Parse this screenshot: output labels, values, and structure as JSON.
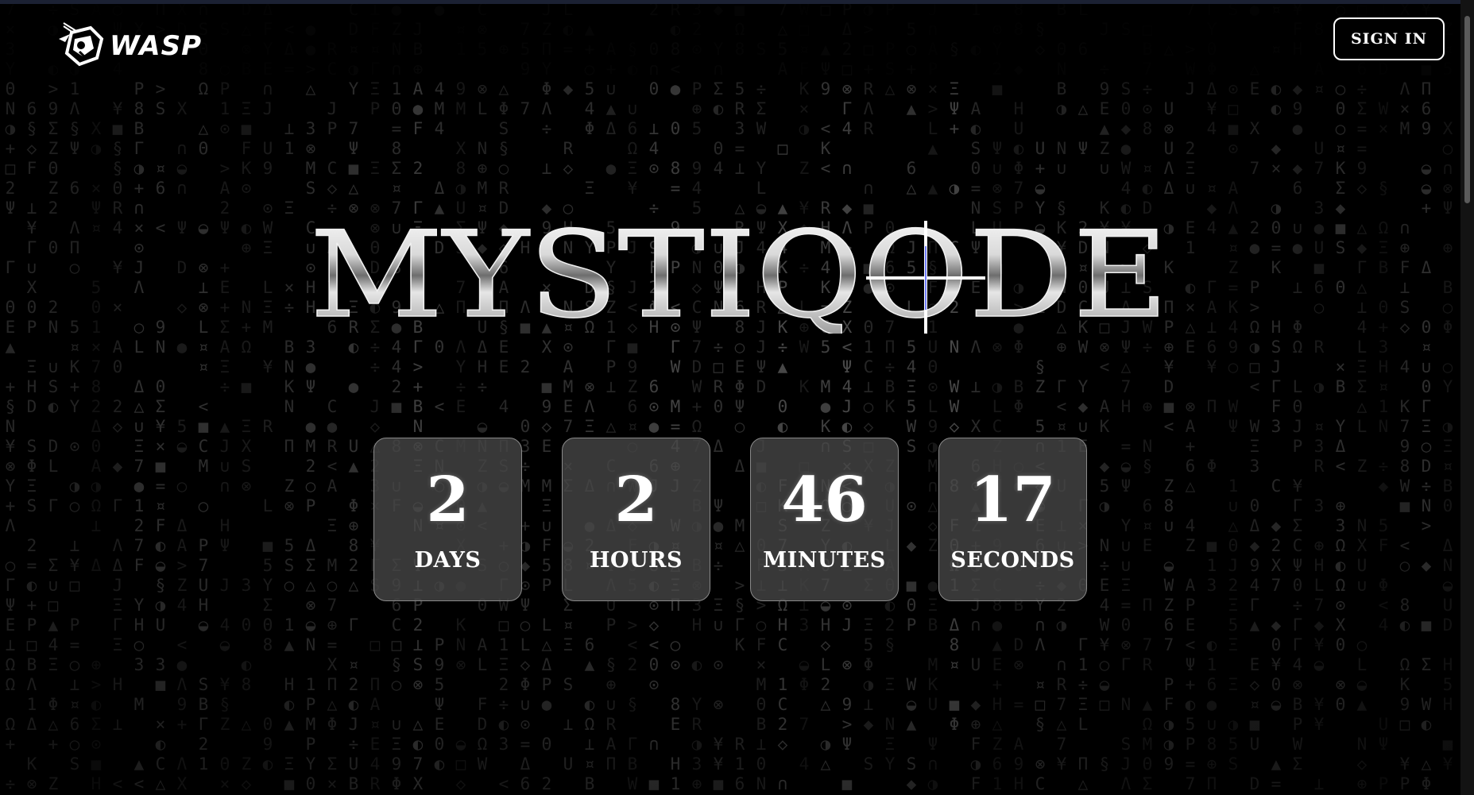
{
  "header": {
    "logo_text": "WASP",
    "signin_label": "SIGN IN"
  },
  "hero": {
    "title": "MYSTIQODE"
  },
  "countdown": [
    {
      "value": "2",
      "label": "DAYS"
    },
    {
      "value": "2",
      "label": "HOURS"
    },
    {
      "value": "46",
      "label": "MINUTES"
    },
    {
      "value": "17",
      "label": "SECONDS"
    }
  ],
  "icons": {
    "logo": "wasp-icon",
    "title_ornament": "crosshair-icon"
  },
  "colors": {
    "background": "#000000",
    "card_bg": "#484848",
    "text": "#ffffff",
    "rain": "#9b9b9b"
  }
}
